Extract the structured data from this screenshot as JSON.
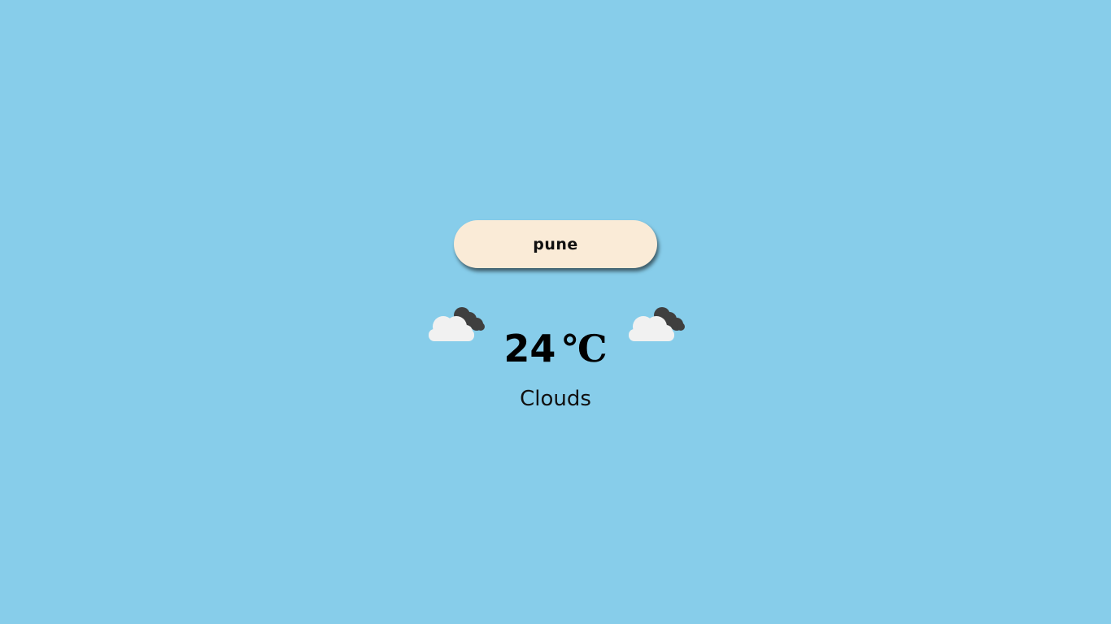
{
  "search": {
    "value": "pune",
    "placeholder": ""
  },
  "weather": {
    "temperature": "24",
    "unit": "℃",
    "condition": "Clouds",
    "icon": "cloudy-icon"
  },
  "colors": {
    "background": "#87cdea",
    "search_background": "#faebd7",
    "cloud_light": "#f1f1f1",
    "cloud_dark": "#3f3f3f"
  }
}
